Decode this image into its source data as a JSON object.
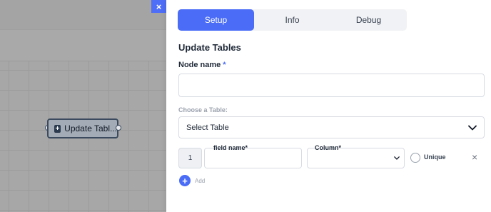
{
  "canvas": {
    "node_label": "Update Tabl...",
    "close_symbol": "×"
  },
  "panel": {
    "tabs": [
      {
        "label": "Setup",
        "active": true
      },
      {
        "label": "Info",
        "active": false
      },
      {
        "label": "Debug",
        "active": false
      }
    ],
    "title": "Update Tables",
    "node_name_label": "Node name",
    "required_mark": "*",
    "node_name_value": "",
    "choose_table_label": "Choose a Table:",
    "select_table_value": "Select Table",
    "rows": [
      {
        "index": "1",
        "field_name_label": "field name*",
        "field_name_value": "",
        "column_label": "Column*",
        "column_value": "",
        "unique_label": "Unique",
        "remove_symbol": "×"
      }
    ],
    "add_symbol": "+",
    "add_label": "Add"
  },
  "colors": {
    "accent": "#4a6cf7",
    "canvas_bg": "#a7a7a7"
  },
  "icons": [
    "close-icon",
    "plus-square-icon",
    "chevron-down-icon",
    "radio-icon",
    "plus-circle-icon"
  ]
}
